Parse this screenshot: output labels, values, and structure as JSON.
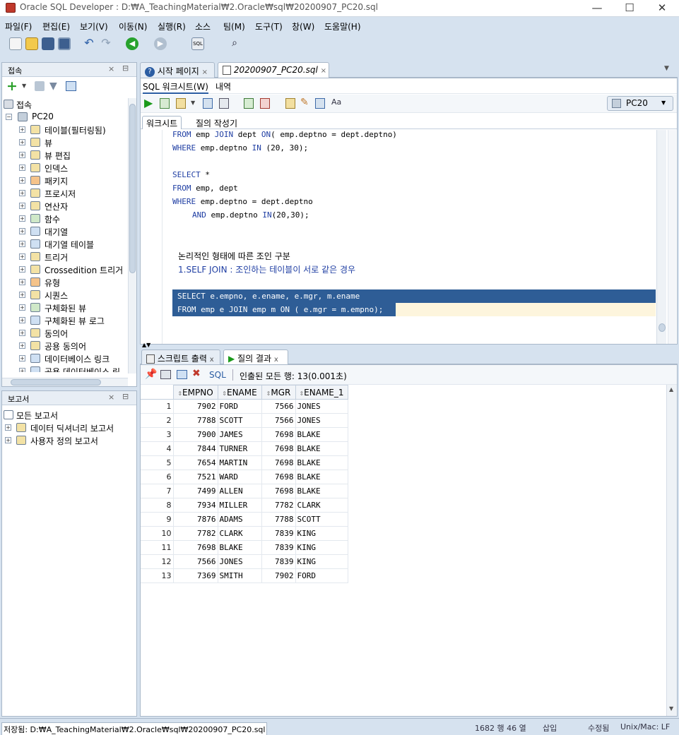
{
  "window": {
    "title": "Oracle SQL Developer : D:₩A_TeachingMaterial₩2.Oracle₩sql₩20200907_PC20.sql",
    "minimize": "—",
    "maximize": "☐",
    "close": "✕"
  },
  "menu": [
    "파일(F)",
    "편집(E)",
    "보기(V)",
    "이동(N)",
    "실행(R)",
    "소스",
    "팀(M)",
    "도구(T)",
    "창(W)",
    "도움말(H)"
  ],
  "connections_panel": {
    "title": "접속",
    "root": "접속",
    "connection": "PC20",
    "items": [
      "테이블(필터링됨)",
      "뷰",
      "뷰 편집",
      "인덱스",
      "패키지",
      "프로시저",
      "연산자",
      "함수",
      "대기열",
      "대기열 테이블",
      "트리거",
      "Crossedition 트리거",
      "유형",
      "시퀀스",
      "구체화된 뷰",
      "구체화된 뷰 로그",
      "동의어",
      "공용 동의어",
      "데이터베이스 링크",
      "공용 데이터베이스 링"
    ]
  },
  "reports_panel": {
    "title": "보고서",
    "items": [
      "모든 보고서",
      "데이터 딕셔너리 보고서",
      "사용자 정의 보고서"
    ]
  },
  "editor_tabs": [
    {
      "label": "시작 페이지",
      "close": "×"
    },
    {
      "label": "20200907_PC20.sql",
      "close": "×"
    }
  ],
  "subtabs": {
    "worksheet": "SQL 워크시트(W)",
    "history": "내역"
  },
  "connection_selector": "PC20",
  "worksheet_tabs": {
    "worksheet": "워크시트",
    "query_builder": "질의 작성기"
  },
  "code": {
    "l1": [
      "FROM",
      " emp ",
      "JOIN",
      " dept ",
      "ON",
      "( emp.deptno = dept.deptno)"
    ],
    "l2": [
      "WHERE",
      " emp.deptno ",
      "IN",
      " (20, 30);"
    ],
    "l3": [
      "SELECT",
      " *"
    ],
    "l4": [
      "FROM",
      " emp, dept"
    ],
    "l5": [
      "WHERE",
      " emp.deptno = dept.deptno"
    ],
    "l6": [
      "AND",
      " emp.deptno ",
      "IN",
      "(20,30);"
    ],
    "c1": "논리적인 형태에 따른 조인 구분",
    "c2": "1.SELF JOIN : 조인하는 테이블이 서로 같은 경우",
    "s1": "SELECT e.empno, e.ename, e.mgr, m.ename",
    "s2": "FROM emp e JOIN emp m ON ( e.mgr = m.empno);"
  },
  "output_tabs": [
    {
      "label": "스크립트 출력",
      "close": "x"
    },
    {
      "label": "질의 결과",
      "close": "x"
    }
  ],
  "result_toolbar": {
    "sql": "SQL",
    "status": "인출된 모든 행: 13(0.001초)"
  },
  "result": {
    "columns": [
      "EMPNO",
      "ENAME",
      "MGR",
      "ENAME_1"
    ],
    "rows": [
      [
        1,
        7902,
        "FORD",
        7566,
        "JONES"
      ],
      [
        2,
        7788,
        "SCOTT",
        7566,
        "JONES"
      ],
      [
        3,
        7900,
        "JAMES",
        7698,
        "BLAKE"
      ],
      [
        4,
        7844,
        "TURNER",
        7698,
        "BLAKE"
      ],
      [
        5,
        7654,
        "MARTIN",
        7698,
        "BLAKE"
      ],
      [
        6,
        7521,
        "WARD",
        7698,
        "BLAKE"
      ],
      [
        7,
        7499,
        "ALLEN",
        7698,
        "BLAKE"
      ],
      [
        8,
        7934,
        "MILLER",
        7782,
        "CLARK"
      ],
      [
        9,
        7876,
        "ADAMS",
        7788,
        "SCOTT"
      ],
      [
        10,
        7782,
        "CLARK",
        7839,
        "KING"
      ],
      [
        11,
        7698,
        "BLAKE",
        7839,
        "KING"
      ],
      [
        12,
        7566,
        "JONES",
        7839,
        "KING"
      ],
      [
        13,
        7369,
        "SMITH",
        7902,
        "FORD"
      ]
    ]
  },
  "status": {
    "path": "저장됨: D:₩A_TeachingMaterial₩2.Oracle₩sql₩20200907_PC20.sql",
    "position": "1682 행 46 열",
    "mode": "삽입",
    "modified": "수정됨",
    "eol": "Unix/Mac: LF"
  }
}
